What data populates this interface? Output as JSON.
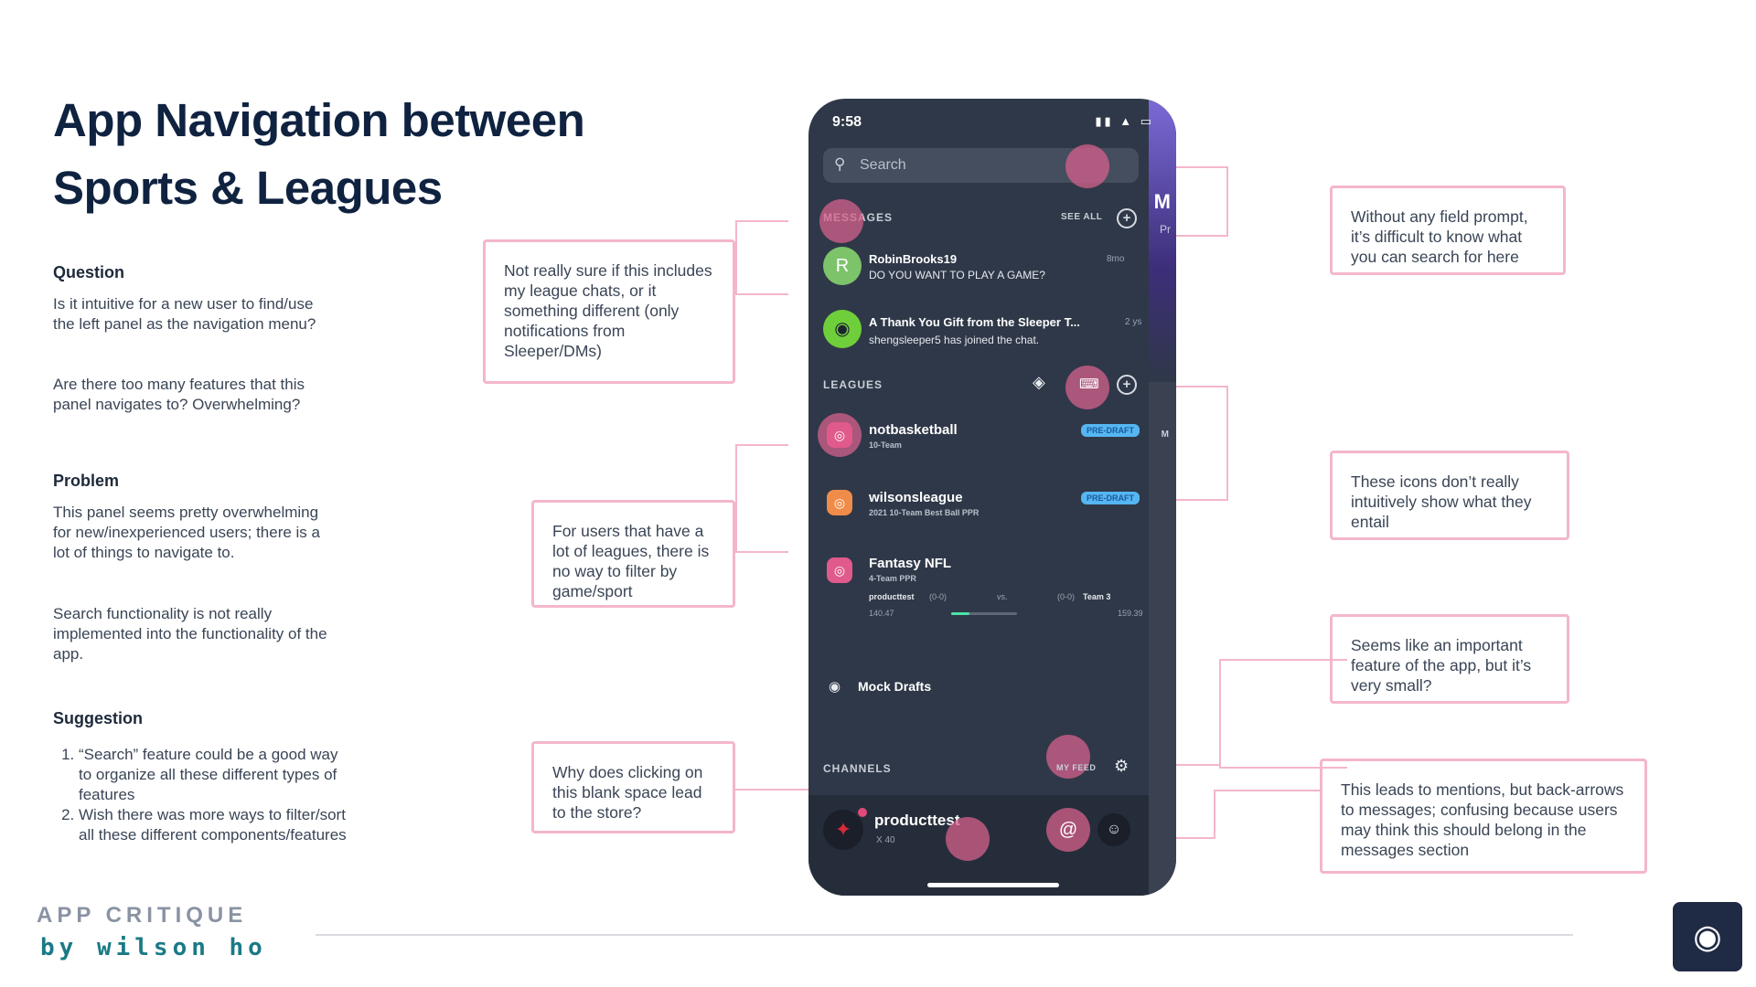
{
  "title_line1": "App Navigation between",
  "title_line2": "Sports & Leagues",
  "question": {
    "heading": "Question",
    "p1": "Is it intuitive for a new user to find/use the left panel as the navigation menu?",
    "p2": "Are there too many features that this panel navigates to? Overwhelming?"
  },
  "problem": {
    "heading": "Problem",
    "p1": "This panel seems pretty overwhelming for new/inexperienced users; there is a lot of things to navigate to.",
    "p2": "Search functionality is not really implemented into the functionality of the app."
  },
  "suggestion": {
    "heading": "Suggestion",
    "items": [
      "“Search” feature could be a good way to organize all these different types of features",
      "Wish there was more ways to filter/sort all these different components/features"
    ]
  },
  "brand": {
    "line1": "APP CRITIQUE",
    "line2": "by wilson ho"
  },
  "notes": {
    "messages": "Not really sure if this includes my league chats, or it something different (only notifications from Sleeper/DMs)",
    "leagues": "For users that have a lot of leagues, there is no way to filter by game/sport",
    "blank": "Why does clicking on this blank space lead to the store?",
    "search": "Without any field prompt, it’s difficult to know what you can search for here",
    "icons": "These icons don’t really intuitively show what they entail",
    "myfeed": "Seems like an important feature of the app, but it’s very small?",
    "mentions": "This leads to mentions, but back-arrows to messages; confusing because users may think this should belong in the messages section"
  },
  "phone": {
    "time": "9:58",
    "search_placeholder": "Search",
    "messages_label": "MESSAGES",
    "see_all": "SEE ALL",
    "messages": [
      {
        "name": "RobinBrooks19",
        "text": "DO YOU WANT TO PLAY A GAME?",
        "time": "8mo",
        "avatar": "R"
      },
      {
        "name": "A Thank You Gift from the Sleeper T...",
        "text": "shengsleeper5 has joined the chat.",
        "time": "2 ys"
      }
    ],
    "leagues_label": "LEAGUES",
    "leagues": [
      {
        "name": "notbasketball",
        "sub": "10-Team",
        "badge": "PRE-DRAFT"
      },
      {
        "name": "wilsonsleague",
        "sub": "2021 10-Team Best Ball PPR",
        "badge": "PRE-DRAFT"
      },
      {
        "name": "Fantasy NFL",
        "sub": "4-Team PPR"
      }
    ],
    "matchup": {
      "team1": "producttest",
      "rec1": "(0-0)",
      "vs": "vs.",
      "rec2": "(0-0)",
      "team2": "Team 3",
      "score1": "140.47",
      "score2": "159.39"
    },
    "mock_drafts": "Mock Drafts",
    "channels_label": "CHANNELS",
    "my_feed": "MY FEED",
    "user": {
      "name": "producttest",
      "sub": "X 40"
    },
    "side_letter": "M",
    "side_sub": "Pr",
    "side_mid": "M"
  }
}
